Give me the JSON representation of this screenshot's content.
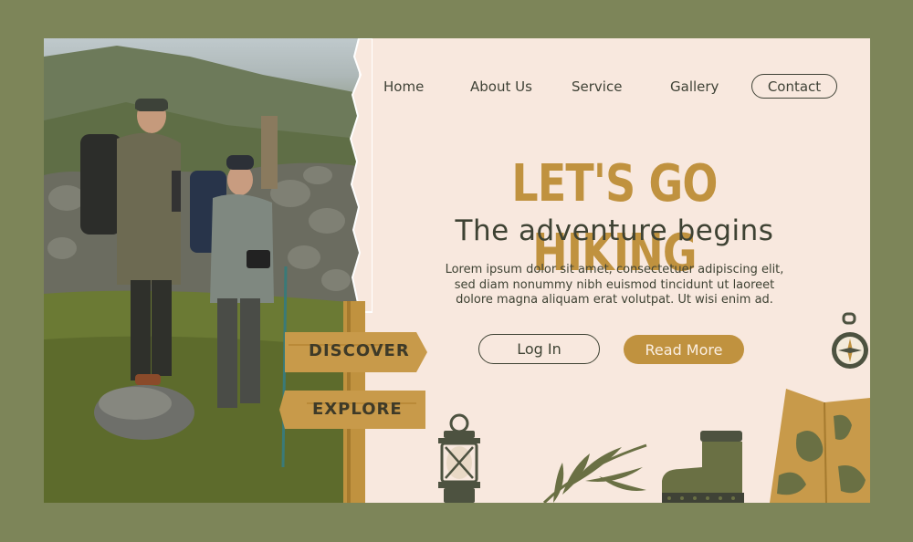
{
  "nav": {
    "items": [
      {
        "label": "Home"
      },
      {
        "label": "About Us"
      },
      {
        "label": "Service"
      },
      {
        "label": "Gallery"
      }
    ],
    "contact_label": "Contact"
  },
  "hero": {
    "headline": "LET'S GO HIKING",
    "subheadline": "The adventure begins",
    "body": [
      "Lorem ipsum dolor sit amet, consectetuer adipiscing elit,",
      "sed diam nonummy nibh euismod tincidunt ut laoreet",
      "dolore magna aliquam erat volutpat. Ut wisi enim ad."
    ],
    "login_label": "Log In",
    "readmore_label": "Read More"
  },
  "signpost": {
    "top": "DISCOVER",
    "bottom": "EXPLORE"
  },
  "colors": {
    "background": "#7d8559",
    "panel": "#f8e8de",
    "accent": "#c0923f",
    "text": "#3e4233",
    "olive": "#6a7044"
  },
  "icons": [
    "compass-icon",
    "lantern-icon",
    "leaf-icon",
    "boot-icon",
    "map-icon"
  ]
}
